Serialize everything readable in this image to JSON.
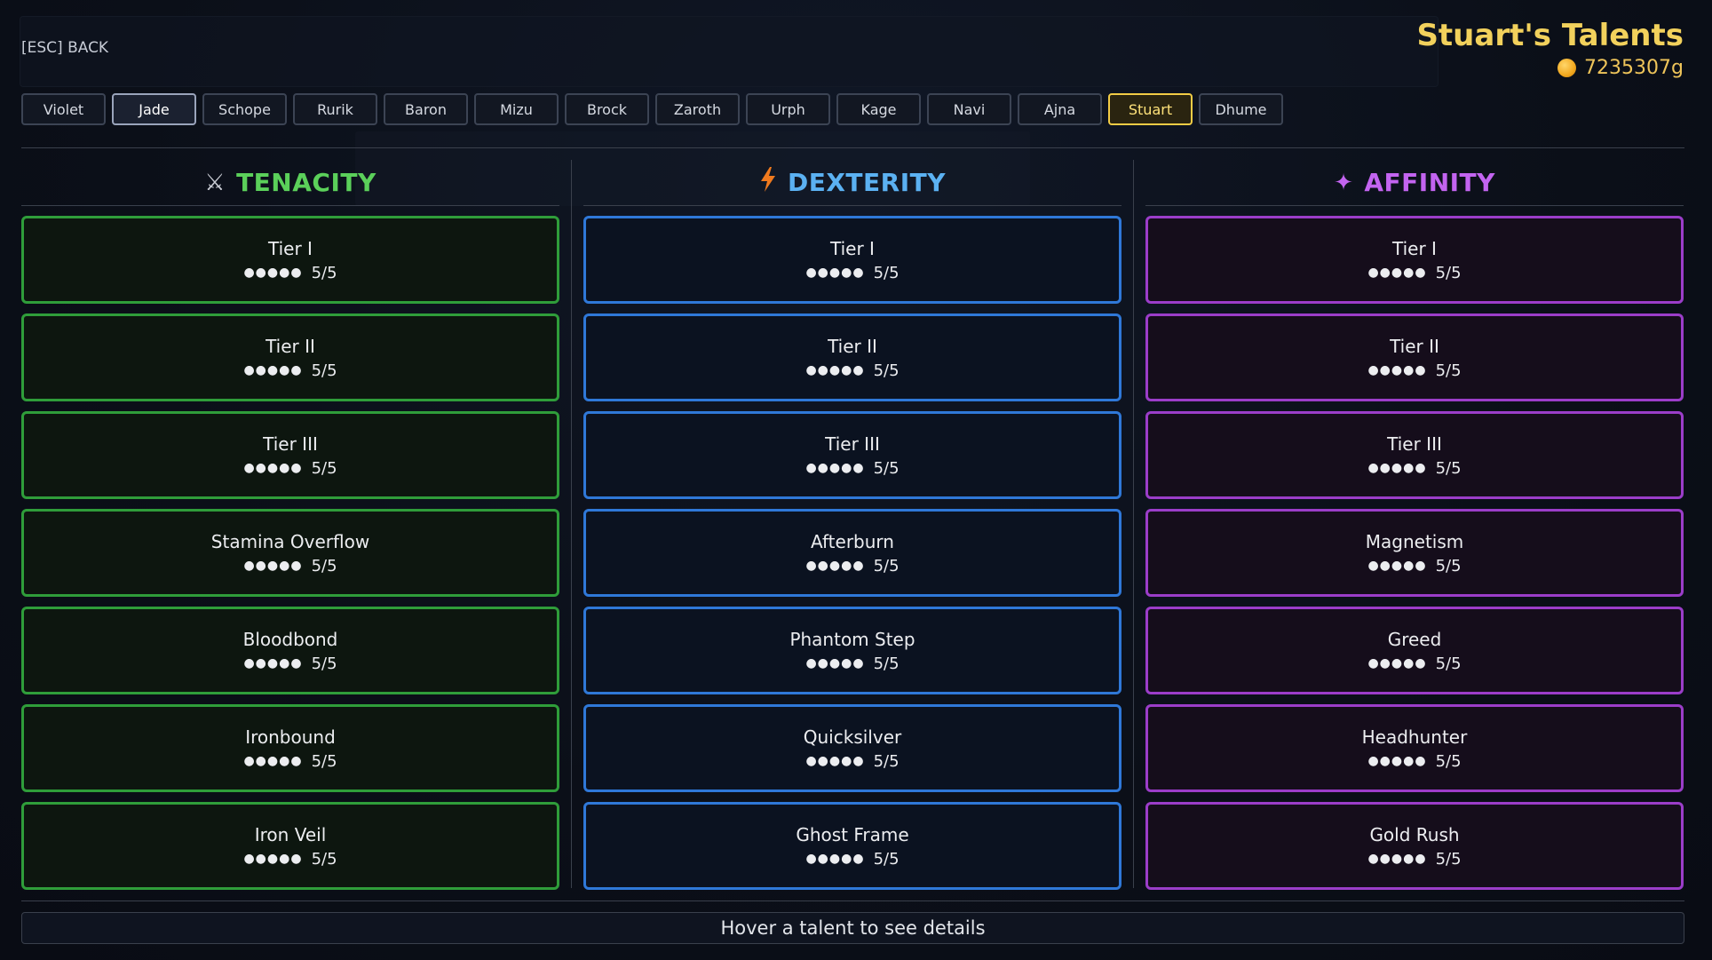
{
  "header": {
    "esc_back": "[ESC] BACK",
    "title": "Stuart's Talents",
    "gold": "7235307g"
  },
  "tabs": [
    {
      "label": "Violet",
      "state": "normal"
    },
    {
      "label": "Jade",
      "state": "hovered"
    },
    {
      "label": "Schope",
      "state": "normal"
    },
    {
      "label": "Rurik",
      "state": "normal"
    },
    {
      "label": "Baron",
      "state": "normal"
    },
    {
      "label": "Mizu",
      "state": "normal"
    },
    {
      "label": "Brock",
      "state": "normal"
    },
    {
      "label": "Zaroth",
      "state": "normal"
    },
    {
      "label": "Urph",
      "state": "normal"
    },
    {
      "label": "Kage",
      "state": "normal"
    },
    {
      "label": "Navi",
      "state": "normal"
    },
    {
      "label": "Ajna",
      "state": "normal"
    },
    {
      "label": "Stuart",
      "state": "active"
    },
    {
      "label": "Dhume",
      "state": "normal"
    }
  ],
  "trees": {
    "tenacity": {
      "title": "TENACITY",
      "icon": "crossed-swords-icon",
      "color": "#2f9d3a",
      "talents": [
        {
          "name": "Tier I",
          "dots": "●●●●●",
          "rank": "5/5"
        },
        {
          "name": "Tier II",
          "dots": "●●●●●",
          "rank": "5/5"
        },
        {
          "name": "Tier III",
          "dots": "●●●●●",
          "rank": "5/5"
        },
        {
          "name": "Stamina Overflow",
          "dots": "●●●●●",
          "rank": "5/5"
        },
        {
          "name": "Bloodbond",
          "dots": "●●●●●",
          "rank": "5/5"
        },
        {
          "name": "Ironbound",
          "dots": "●●●●●",
          "rank": "5/5"
        },
        {
          "name": "Iron Veil",
          "dots": "●●●●●",
          "rank": "5/5"
        }
      ]
    },
    "dexterity": {
      "title": "DEXTERITY",
      "icon": "lightning-icon",
      "color": "#2f78d8",
      "talents": [
        {
          "name": "Tier I",
          "dots": "●●●●●",
          "rank": "5/5"
        },
        {
          "name": "Tier II",
          "dots": "●●●●●",
          "rank": "5/5"
        },
        {
          "name": "Tier III",
          "dots": "●●●●●",
          "rank": "5/5"
        },
        {
          "name": "Afterburn",
          "dots": "●●●●●",
          "rank": "5/5"
        },
        {
          "name": "Phantom Step",
          "dots": "●●●●●",
          "rank": "5/5"
        },
        {
          "name": "Quicksilver",
          "dots": "●●●●●",
          "rank": "5/5"
        },
        {
          "name": "Ghost Frame",
          "dots": "●●●●●",
          "rank": "5/5"
        }
      ]
    },
    "affinity": {
      "title": "AFFINITY",
      "icon": "sparkle-icon",
      "color": "#9b3dc9",
      "talents": [
        {
          "name": "Tier I",
          "dots": "●●●●●",
          "rank": "5/5"
        },
        {
          "name": "Tier II",
          "dots": "●●●●●",
          "rank": "5/5"
        },
        {
          "name": "Tier III",
          "dots": "●●●●●",
          "rank": "5/5"
        },
        {
          "name": "Magnetism",
          "dots": "●●●●●",
          "rank": "5/5"
        },
        {
          "name": "Greed",
          "dots": "●●●●●",
          "rank": "5/5"
        },
        {
          "name": "Headhunter",
          "dots": "●●●●●",
          "rank": "5/5"
        },
        {
          "name": "Gold Rush",
          "dots": "●●●●●",
          "rank": "5/5"
        }
      ]
    }
  },
  "footer": {
    "hint": "Hover a talent to see details"
  }
}
